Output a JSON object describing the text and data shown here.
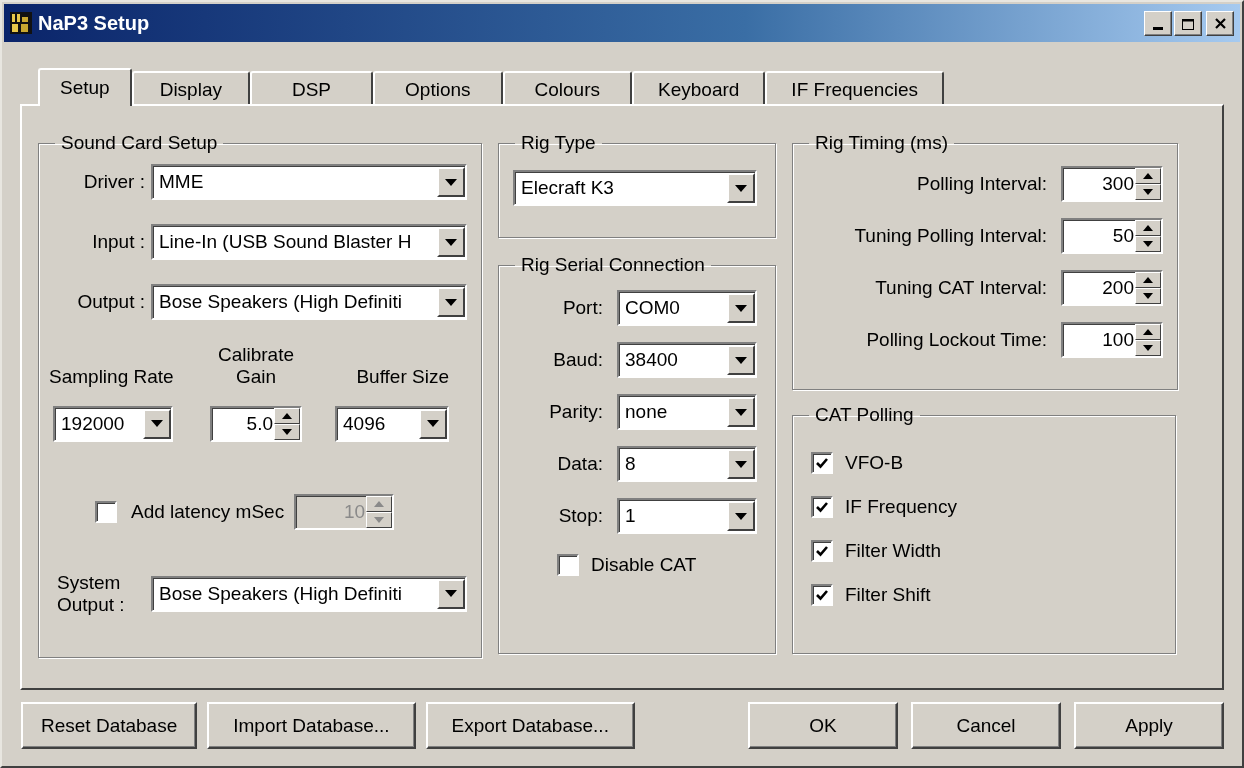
{
  "window": {
    "title": "NaP3 Setup"
  },
  "tabs": [
    {
      "label": "Setup",
      "selected": true
    },
    {
      "label": "Display",
      "selected": false
    },
    {
      "label": "DSP",
      "selected": false
    },
    {
      "label": "Options",
      "selected": false
    },
    {
      "label": "Colours",
      "selected": false
    },
    {
      "label": "Keyboard",
      "selected": false
    },
    {
      "label": "IF Frequencies",
      "selected": false
    }
  ],
  "sound_card": {
    "title": "Sound Card Setup",
    "devices": [
      {
        "label": "Driver :",
        "kind": "dropdown",
        "value": "MME"
      },
      {
        "label": "Input :",
        "kind": "dropdown",
        "value": "Line-In (USB Sound Blaster H"
      },
      {
        "label": "Output :",
        "kind": "dropdown",
        "value": "Bose Speakers (High Definiti"
      }
    ],
    "settings": [
      {
        "label": "Sampling Rate",
        "kind": "dropdown",
        "value": "192000"
      },
      {
        "label": "Calibrate Gain",
        "kind": "spinner",
        "value": "5.0"
      },
      {
        "label": "Buffer Size",
        "kind": "dropdown",
        "value": "4096"
      }
    ],
    "latency": {
      "label": "Add  latency mSec",
      "checked": false,
      "kind": "spinner",
      "value": "10",
      "disabled": true
    },
    "system_output": {
      "label": "System Output :",
      "kind": "dropdown",
      "value": "Bose Speakers (High Definiti"
    }
  },
  "rig_type": {
    "title": "Rig Type",
    "kind": "dropdown",
    "value": "Elecraft K3"
  },
  "rig_serial": {
    "title": "Rig Serial Connection",
    "fields": [
      {
        "label": "Port:",
        "kind": "dropdown",
        "value": "COM0"
      },
      {
        "label": "Baud:",
        "kind": "dropdown",
        "value": "38400"
      },
      {
        "label": "Parity:",
        "kind": "dropdown",
        "value": "none"
      },
      {
        "label": "Data:",
        "kind": "dropdown",
        "value": "8"
      },
      {
        "label": "Stop:",
        "kind": "dropdown",
        "value": "1"
      }
    ],
    "disable_cat": {
      "label": "Disable CAT",
      "checked": false
    }
  },
  "rig_timing": {
    "title": "Rig Timing (ms)",
    "fields": [
      {
        "label": "Polling Interval:",
        "kind": "spinner",
        "value": "300"
      },
      {
        "label": "Tuning Polling Interval:",
        "kind": "spinner",
        "value": "50"
      },
      {
        "label": "Tuning CAT Interval:",
        "kind": "spinner",
        "value": "200"
      },
      {
        "label": "Polling Lockout Time:",
        "kind": "spinner",
        "value": "100"
      }
    ]
  },
  "cat_polling": {
    "title": "CAT Polling",
    "items": [
      {
        "label": "VFO-B",
        "checked": true
      },
      {
        "label": "IF Frequency",
        "checked": true
      },
      {
        "label": "Filter Width",
        "checked": true
      },
      {
        "label": "Filter Shift",
        "checked": true
      }
    ]
  },
  "database_buttons": [
    "Reset Database",
    "Import Database...",
    "Export Database..."
  ],
  "dialog_buttons": [
    "OK",
    "Cancel",
    "Apply"
  ]
}
